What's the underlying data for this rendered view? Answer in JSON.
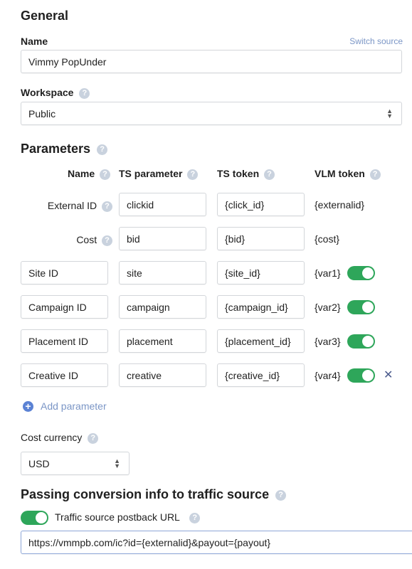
{
  "general": {
    "title": "General",
    "name_label": "Name",
    "switch_source": "Switch source",
    "name_value": "Vimmy PopUnder",
    "workspace_label": "Workspace",
    "workspace_value": "Public"
  },
  "parameters": {
    "title": "Parameters",
    "headers": {
      "name": "Name",
      "ts_parameter": "TS parameter",
      "ts_token": "TS token",
      "vlm_token": "VLM token"
    },
    "fixed_rows": [
      {
        "name": "External ID",
        "ts_parameter": "clickid",
        "ts_token": "{click_id}",
        "vlm_token": "{externalid}"
      },
      {
        "name": "Cost",
        "ts_parameter": "bid",
        "ts_token": "{bid}",
        "vlm_token": "{cost}"
      }
    ],
    "custom_rows": [
      {
        "name": "Site ID",
        "ts_parameter": "site",
        "ts_token": "{site_id}",
        "vlm_token": "{var1}",
        "enabled": true
      },
      {
        "name": "Campaign ID",
        "ts_parameter": "campaign",
        "ts_token": "{campaign_id}",
        "vlm_token": "{var2}",
        "enabled": true
      },
      {
        "name": "Placement ID",
        "ts_parameter": "placement",
        "ts_token": "{placement_id}",
        "vlm_token": "{var3}",
        "enabled": true
      },
      {
        "name": "Creative ID",
        "ts_parameter": "creative",
        "ts_token": "{creative_id}",
        "vlm_token": "{var4}",
        "enabled": true
      }
    ],
    "add_parameter": "Add parameter"
  },
  "currency": {
    "label": "Cost currency",
    "value": "USD"
  },
  "conversion": {
    "title": "Passing conversion info to traffic source",
    "postback_label": "Traffic source postback URL",
    "postback_enabled": true,
    "postback_url": "https://vmmpb.com/ic?id={externalid}&payout={payout}"
  },
  "icons": {
    "help": "?",
    "close": "✕",
    "add": "+"
  },
  "colors": {
    "toggle_on": "#2ea65a",
    "link": "#7b96c6",
    "help_icon": "#c9d2de"
  }
}
